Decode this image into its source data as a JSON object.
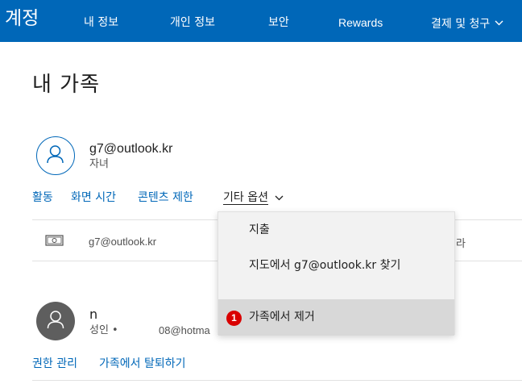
{
  "header": {
    "brand": "계정",
    "nav": [
      "내 정보",
      "개인 정보",
      "보안",
      "Rewards",
      "결제 및 청구"
    ],
    "accent": "#0067b8"
  },
  "page": {
    "title": "내 가족"
  },
  "member1": {
    "name": "g7@outlook.kr",
    "role": "자녀",
    "links": {
      "activity": "활동",
      "screen_time": "화면 시간",
      "content_limits": "콘텐츠 제한",
      "more_options": "기타 옵션"
    },
    "spending_email": "g7@outlook.kr"
  },
  "member2": {
    "name": "n",
    "role": "성인 •",
    "email_partial": "08@hotma",
    "links": {
      "manage_permissions": "권한 관리",
      "leave_family": "가족에서 탈퇴하기"
    }
  },
  "dropdown": {
    "items": [
      "지출",
      "지도에서 g7@outlook.kr 찾기",
      "가족에서 제거"
    ],
    "badge": "1",
    "behind_char": "라"
  }
}
